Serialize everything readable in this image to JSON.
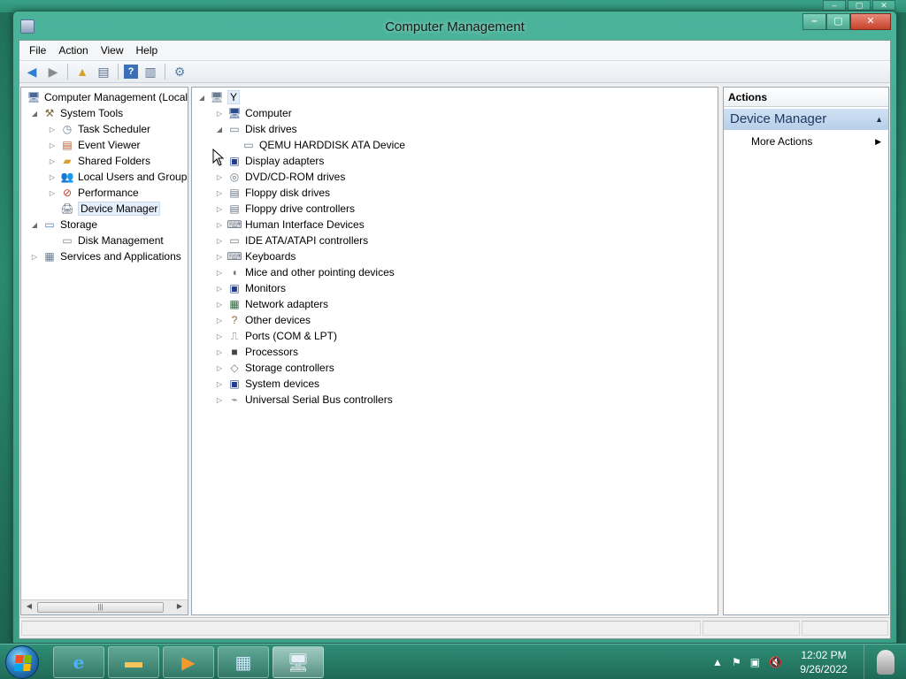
{
  "window": {
    "title": "Computer Management"
  },
  "menu": [
    "File",
    "Action",
    "View",
    "Help"
  ],
  "left_tree": {
    "root": "Computer Management (Local",
    "items": [
      {
        "label": "System Tools",
        "expander": "◢",
        "indent": 1,
        "icon": "tools-icon"
      },
      {
        "label": "Task Scheduler",
        "expander": "▷",
        "indent": 2,
        "icon": "clock-icon"
      },
      {
        "label": "Event Viewer",
        "expander": "▷",
        "indent": 2,
        "icon": "event-viewer-icon"
      },
      {
        "label": "Shared Folders",
        "expander": "▷",
        "indent": 2,
        "icon": "shared-folder-icon"
      },
      {
        "label": "Local Users and Groups",
        "expander": "▷",
        "indent": 2,
        "icon": "users-icon"
      },
      {
        "label": "Performance",
        "expander": "▷",
        "indent": 2,
        "icon": "performance-icon"
      },
      {
        "label": "Device Manager",
        "expander": "",
        "indent": 2,
        "icon": "device-manager-icon",
        "selected": true
      },
      {
        "label": "Storage",
        "expander": "◢",
        "indent": 1,
        "icon": "storage-icon"
      },
      {
        "label": "Disk Management",
        "expander": "",
        "indent": 2,
        "icon": "disk-management-icon"
      },
      {
        "label": "Services and Applications",
        "expander": "▷",
        "indent": 1,
        "icon": "services-icon"
      }
    ]
  },
  "device_tree": {
    "root": "Y",
    "categories": [
      {
        "label": "Computer",
        "expander": "▷",
        "icon": "computer-icon"
      },
      {
        "label": "Disk drives",
        "expander": "◢",
        "icon": "disk-drive-icon"
      },
      {
        "label": "QEMU HARDDISK ATA Device",
        "expander": "",
        "icon": "harddisk-icon",
        "child": true
      },
      {
        "label": "Display adapters",
        "expander": "▷",
        "icon": "display-adapter-icon"
      },
      {
        "label": "DVD/CD-ROM drives",
        "expander": "▷",
        "icon": "dvd-icon"
      },
      {
        "label": "Floppy disk drives",
        "expander": "▷",
        "icon": "floppy-icon"
      },
      {
        "label": "Floppy drive controllers",
        "expander": "▷",
        "icon": "floppy-controller-icon"
      },
      {
        "label": "Human Interface Devices",
        "expander": "▷",
        "icon": "hid-icon"
      },
      {
        "label": "IDE ATA/ATAPI controllers",
        "expander": "▷",
        "icon": "ide-icon"
      },
      {
        "label": "Keyboards",
        "expander": "▷",
        "icon": "keyboard-icon"
      },
      {
        "label": "Mice and other pointing devices",
        "expander": "▷",
        "icon": "mouse-icon"
      },
      {
        "label": "Monitors",
        "expander": "▷",
        "icon": "monitor-icon"
      },
      {
        "label": "Network adapters",
        "expander": "▷",
        "icon": "network-icon"
      },
      {
        "label": "Other devices",
        "expander": "▷",
        "icon": "other-devices-icon"
      },
      {
        "label": "Ports (COM & LPT)",
        "expander": "▷",
        "icon": "ports-icon"
      },
      {
        "label": "Processors",
        "expander": "▷",
        "icon": "processor-icon"
      },
      {
        "label": "Storage controllers",
        "expander": "▷",
        "icon": "storage-controller-icon"
      },
      {
        "label": "System devices",
        "expander": "▷",
        "icon": "system-devices-icon"
      },
      {
        "label": "Universal Serial Bus controllers",
        "expander": "▷",
        "icon": "usb-icon"
      }
    ]
  },
  "actions": {
    "header": "Actions",
    "section": "Device Manager",
    "more": "More Actions"
  },
  "taskbar": {
    "time": "12:02 PM",
    "date": "9/26/2022"
  },
  "colors": {
    "titlebar": "#4ab39a",
    "selection": "#e5eefb",
    "actions_section": "#cfe0f3"
  }
}
